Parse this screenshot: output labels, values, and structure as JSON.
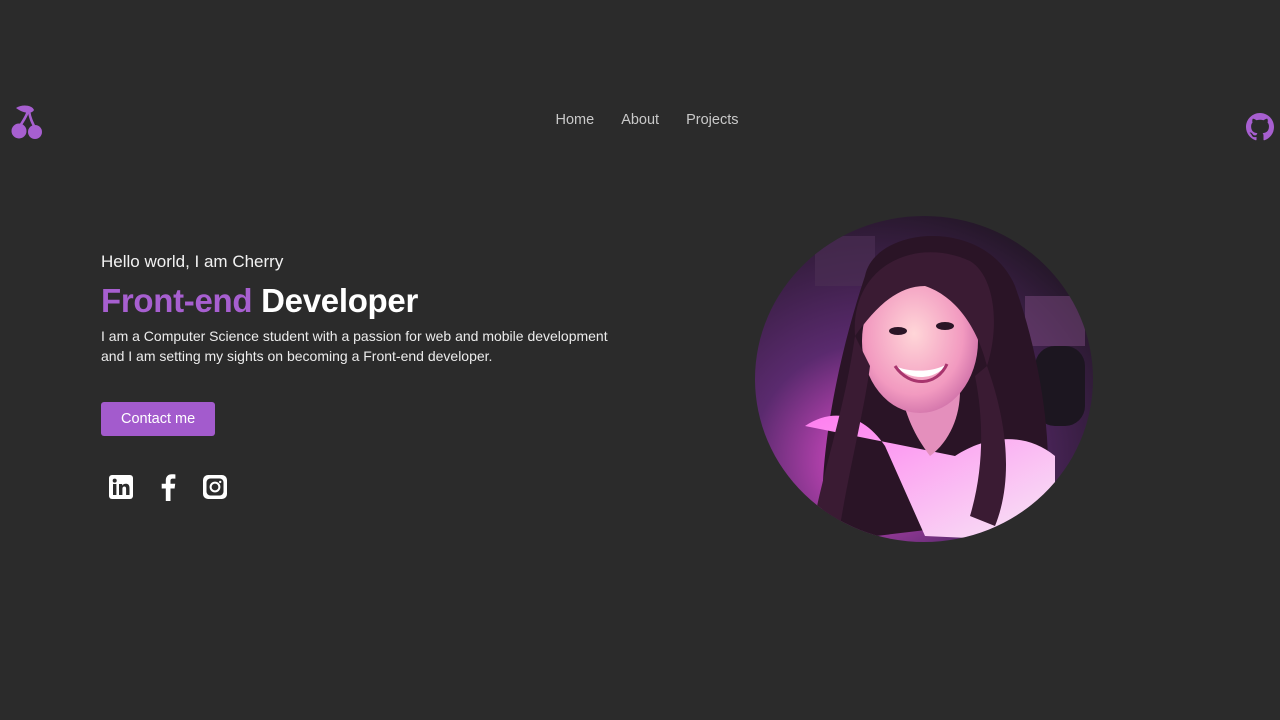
{
  "header": {
    "logo_icon": "cherry-icon",
    "nav": [
      {
        "label": "Home"
      },
      {
        "label": "About"
      },
      {
        "label": "Projects"
      }
    ],
    "github_icon": "github-icon"
  },
  "hero": {
    "greeting": "Hello world, I am Cherry",
    "title_accent": "Front-end",
    "title_rest": "Developer",
    "description_line1": "I am a Computer Science student with a passion for web and mobile development",
    "description_line2": "and I am setting my sights on becoming a Front-end developer.",
    "contact_label": "Contact me"
  },
  "socials": [
    {
      "icon": "linkedin-icon"
    },
    {
      "icon": "facebook-icon"
    },
    {
      "icon": "instagram-icon"
    }
  ],
  "profile_photo": "profile-photo",
  "colors": {
    "background": "#2b2b2b",
    "accent": "#a75fd0",
    "nav_text": "#c9c9c9",
    "text": "#ffffff"
  }
}
